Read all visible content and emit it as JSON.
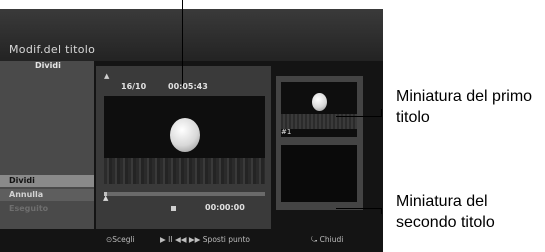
{
  "screen": {
    "title": "Modif.del titolo",
    "side_label": "Dividi",
    "buttons": [
      "Dividi",
      "Annulla",
      "Eseguito"
    ],
    "video": {
      "counter": "16/10",
      "time": "00:05:43",
      "total_time": "00:00:00"
    },
    "thumbnails": [
      {
        "label": "#1"
      },
      {
        "label": ""
      }
    ],
    "footer": {
      "select": "⊙Scegli",
      "move": "▶ II ◀◀ ▶▶ Sposti punto",
      "close": "⤿ Chiudi"
    },
    "progress_fraction": 0.02
  },
  "callouts": {
    "first": "Miniatura del primo titolo",
    "second": "Miniatura del secondo titolo"
  }
}
